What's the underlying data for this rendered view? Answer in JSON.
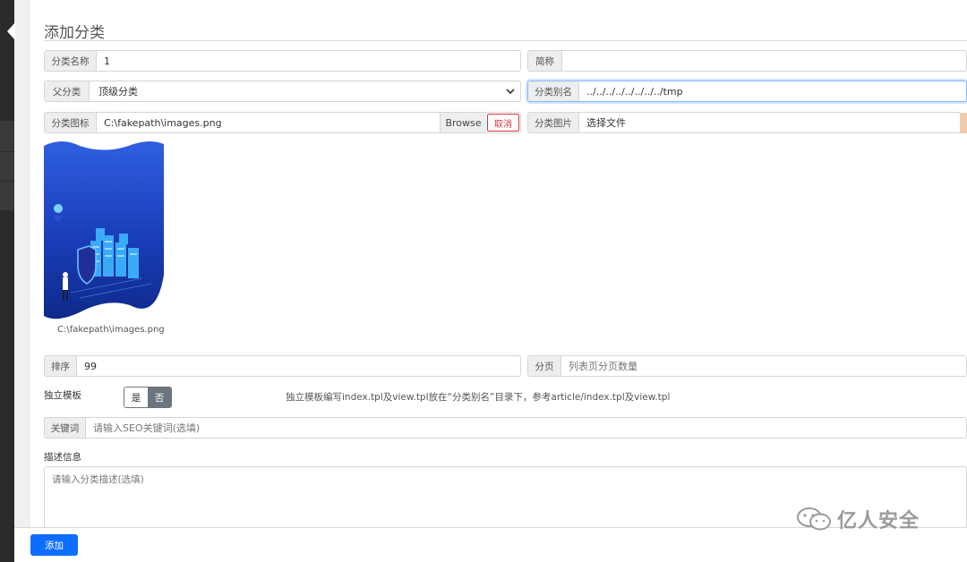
{
  "page": {
    "title": "添加分类"
  },
  "form": {
    "name": {
      "label": "分类名称",
      "value": "1"
    },
    "short_name": {
      "label": "简称",
      "value": ""
    },
    "parent": {
      "label": "父分类",
      "value": "顶级分类"
    },
    "alias": {
      "label": "分类别名",
      "value": "../../../../../../../../tmp"
    },
    "icon": {
      "label": "分类图标",
      "value": "C:\\fakepath\\images.png",
      "browse_label": "Browse",
      "cancel_label": "取消"
    },
    "image": {
      "label": "分类图片",
      "placeholder": "选择文件"
    },
    "preview_caption": "C:\\fakepath\\images.png",
    "sort": {
      "label": "排序",
      "value": "99"
    },
    "paging": {
      "label": "分页",
      "placeholder": "列表页分页数量"
    },
    "template": {
      "label": "独立模板",
      "yes_label": "是",
      "no_label": "否",
      "selected": "否",
      "hint": "独立模板编写index.tpl及view.tpl放在“分类别名”目录下，参考article/index.tpl及view.tpl"
    },
    "keywords": {
      "label": "关键词",
      "placeholder": "请输入SEO关键词(选填)"
    },
    "description": {
      "label": "描述信息",
      "placeholder": "请输入分类描述(选填)"
    },
    "submit_label": "添加"
  },
  "watermark": {
    "text": "亿人安全",
    "icon": "wechat-icon"
  },
  "colors": {
    "primary": "#0d6efd",
    "danger": "#dc3545",
    "toggle_active": "#6c757d",
    "preview_blue": "#1a3db8"
  }
}
